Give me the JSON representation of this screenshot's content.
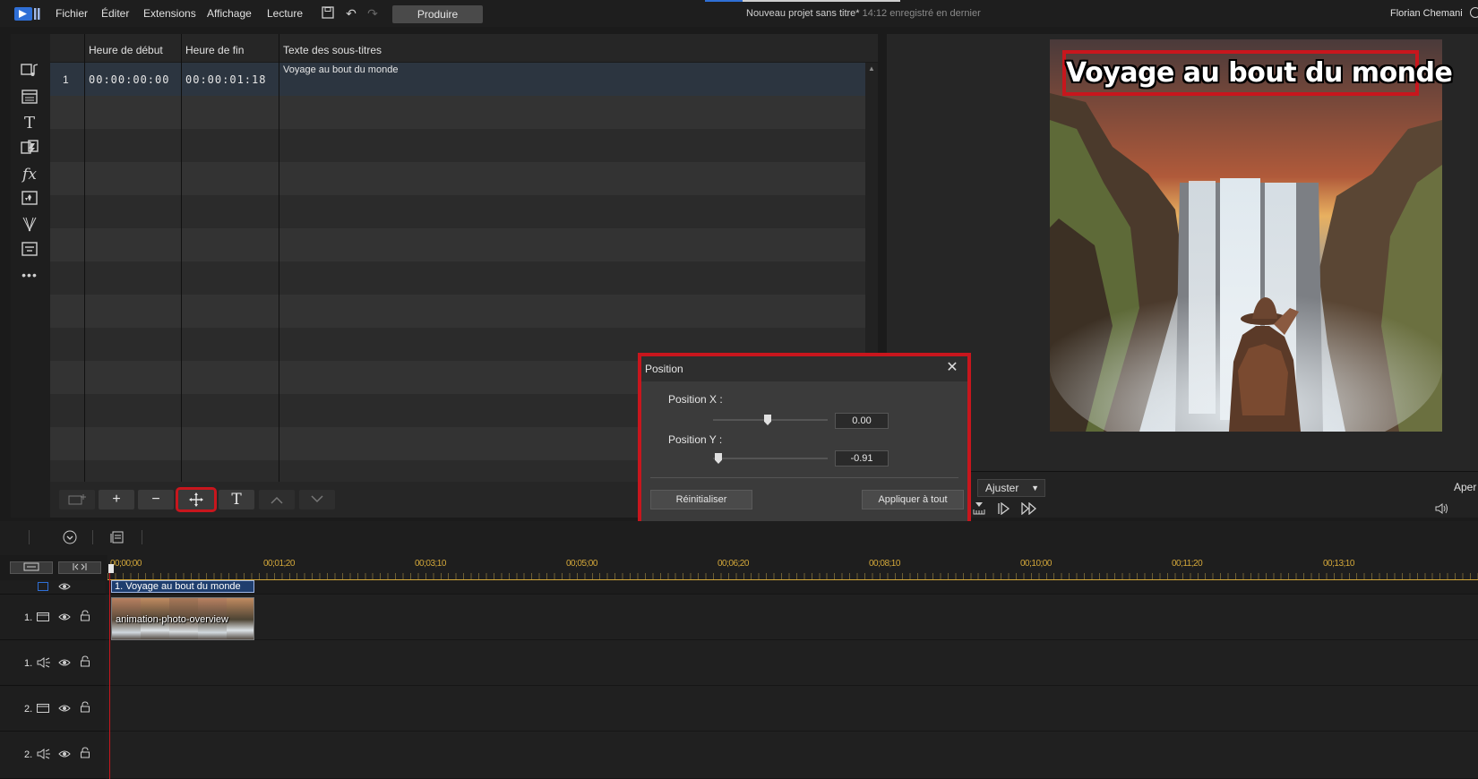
{
  "menubar": {
    "items": [
      "Fichier",
      "Éditer",
      "Extensions",
      "Affichage",
      "Lecture"
    ],
    "produce_label": "Produire",
    "project_name": "Nouveau projet sans titre*",
    "save_status": "14:12 enregistré en dernier",
    "user_name": "Florian Chemani"
  },
  "subtitles": {
    "columns": [
      "Heure de début",
      "Heure de fin",
      "Texte des sous-titres"
    ],
    "rows": [
      {
        "index": "1",
        "start": "00:00:00:00",
        "end": "00:00:01:18",
        "text": "Voyage au bout du monde"
      }
    ]
  },
  "preview": {
    "caption": "Voyage au bout du monde",
    "fit_label": "Ajuster",
    "right_label": "Aper"
  },
  "dialog": {
    "title": "Position",
    "x_label": "Position X :",
    "x_value": "0.00",
    "y_label": "Position Y :",
    "y_value": "-0.91",
    "reset_label": "Réinitialiser",
    "apply_all_label": "Appliquer à tout"
  },
  "timeline": {
    "ruler_labels": [
      "00;00;00",
      "00;01;20",
      "00;03;10",
      "00;05;00",
      "00;06;20",
      "00;08;10",
      "00;10;00",
      "00;11;20",
      "00;13;10"
    ],
    "subtitle_clip": "1. Voyage au bout du monde",
    "video_clip": "animation-photo-overview",
    "track_labels": [
      "1.",
      "1.",
      "2.",
      "2."
    ]
  },
  "colors": {
    "highlight": "#c8161d",
    "ruler": "#d4a83a",
    "accent_blue": "#2f6fd6"
  }
}
